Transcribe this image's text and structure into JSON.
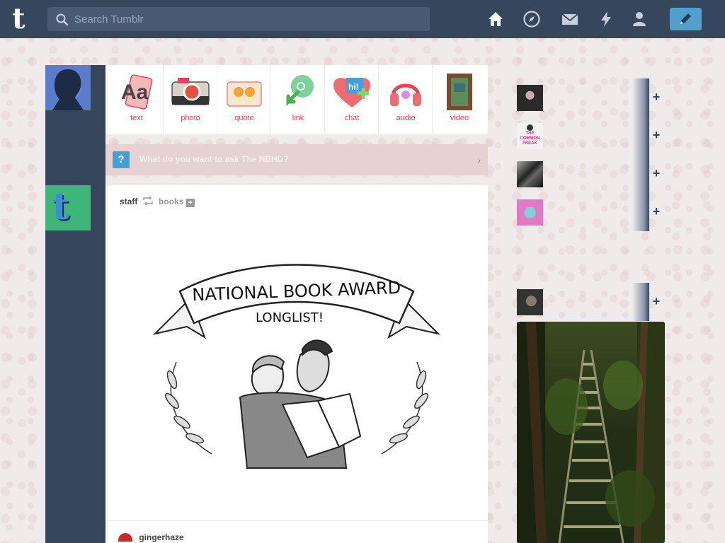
{
  "topbar": {
    "logo": "t",
    "search_placeholder": "Search Tumblr",
    "nav_icons": [
      "home-icon",
      "explore-compass-icon",
      "inbox-mail-icon",
      "activity-lightning-icon",
      "account-person-icon"
    ],
    "compose_icon": "pencil-icon"
  },
  "post_types": [
    {
      "label": "text",
      "icon": "text-post-icon"
    },
    {
      "label": "photo",
      "icon": "photo-post-icon"
    },
    {
      "label": "quote",
      "icon": "quote-post-icon"
    },
    {
      "label": "link",
      "icon": "link-post-icon"
    },
    {
      "label": "chat",
      "icon": "chat-post-icon"
    },
    {
      "label": "audio",
      "icon": "audio-post-icon"
    },
    {
      "label": "video",
      "icon": "video-post-icon"
    }
  ],
  "ask": {
    "icon": "question-icon",
    "text": "What do you want to ask The NBHD?"
  },
  "post": {
    "author": "staff",
    "reblog_icon": "reblog-icon",
    "reblogged_from": "books",
    "banner_line1": "NATIONAL BOOK AWARD",
    "banner_line2": "LONGLIST!",
    "next_author": "gingerhaze"
  },
  "recommended": [
    {
      "avatar": "avatar-dark-hair"
    },
    {
      "avatar": "avatar-the-common-freak",
      "avatar_text": "THE COMMON FREAK"
    },
    {
      "avatar": "avatar-bw-person"
    },
    {
      "avatar": "avatar-pink-cartoon"
    },
    {
      "avatar": "avatar-bearded-man"
    }
  ],
  "colors": {
    "navy": "#36465d",
    "accent_blue": "#529ecc",
    "post_type_red": "#e0465a"
  }
}
